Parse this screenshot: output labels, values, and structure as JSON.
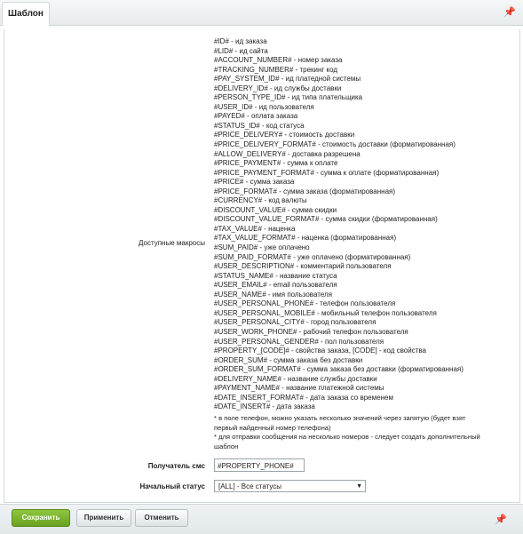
{
  "tabs": [
    {
      "label": "Шаблон"
    }
  ],
  "macros_label": "Доступные макросы",
  "macros": [
    {
      "code": "#ID#",
      "desc": " - ид заказа"
    },
    {
      "code": "#LID#",
      "desc": " - ид сайта"
    },
    {
      "code": "#ACCOUNT_NUMBER#",
      "desc": " - номер заказа"
    },
    {
      "code": "#TRACKING_NUMBER#",
      "desc": " - трекинг код"
    },
    {
      "code": "#PAY_SYSTEM_ID#",
      "desc": " - ид платедной системы"
    },
    {
      "code": "#DELIVERY_ID#",
      "desc": " - ид службы доставки"
    },
    {
      "code": "#PERSON_TYPE_ID#",
      "desc": " - ид типа плательщика"
    },
    {
      "code": "#USER_ID#",
      "desc": " - ид пользователя"
    },
    {
      "code": "#PAYED#",
      "desc": " - оплата заказа"
    },
    {
      "code": "#STATUS_ID#",
      "desc": " - код статуса"
    },
    {
      "code": "#PRICE_DELIVERY#",
      "desc": " - стоимость доставки"
    },
    {
      "code": "#PRICE_DELIVERY_FORMAT#",
      "desc": " - стоимость доставки (форматированная)"
    },
    {
      "code": "#ALLOW_DELIVERY#",
      "desc": " - доставка разрешена"
    },
    {
      "code": "#PRICE_PAYMENT#",
      "desc": " - сумма к оплате"
    },
    {
      "code": "#PRICE_PAYMENT_FORMAT#",
      "desc": " - сумма к оплате (форматированная)"
    },
    {
      "code": "#PRICE#",
      "desc": " - сумма заказа"
    },
    {
      "code": "#PRICE_FORMAT#",
      "desc": " - сумма заказа (форматированная)"
    },
    {
      "code": "#CURRENCY#",
      "desc": " - код валюты"
    },
    {
      "code": "#DISCOUNT_VALUE#",
      "desc": " - сумма скидки"
    },
    {
      "code": "#DISCOUNT_VALUE_FORMAT#",
      "desc": " - сумма скидки (форматированная)"
    },
    {
      "code": "#TAX_VALUE#",
      "desc": " - наценка"
    },
    {
      "code": "#TAX_VALUE_FORMAT#",
      "desc": " - наценка (форматированная)"
    },
    {
      "code": "#SUM_PAID#",
      "desc": " - уже оплачено"
    },
    {
      "code": "#SUM_PAID_FORMAT#",
      "desc": " - уже оплачено (форматированная)"
    },
    {
      "code": "#USER_DESCRIPTION#",
      "desc": " - комментарий пользователя"
    },
    {
      "code": "#STATUS_NAME#",
      "desc": " - название статуса"
    },
    {
      "code": "#USER_EMAIL#",
      "desc": " - email пользователя"
    },
    {
      "code": "#USER_NAME#",
      "desc": " - имя пользователя"
    },
    {
      "code": "#USER_PERSONAL_PHONE#",
      "desc": " - телефон пользователя"
    },
    {
      "code": "#USER_PERSONAL_MOBILE#",
      "desc": " - мобильный телефон пользователя"
    },
    {
      "code": "#USER_PERSONAL_CITY#",
      "desc": " - город пользователя"
    },
    {
      "code": "#USER_WORK_PHONE#",
      "desc": " - рабочий телефон пользователя"
    },
    {
      "code": "#USER_PERSONAL_GENDER#",
      "desc": " - пол пользователя"
    },
    {
      "code": "#PROPERTY_[CODE]#",
      "desc": " - свойства заказа, [CODE] - код свойства"
    },
    {
      "code": "#ORDER_SUM#",
      "desc": " - сумма заказа без доставки"
    },
    {
      "code": "#ORDER_SUM_FORMAT#",
      "desc": " - сумма заказа без доставки (форматированная)"
    },
    {
      "code": "#DELIVERY_NAME#",
      "desc": " - название службы доставки"
    },
    {
      "code": "#PAYMENT_NAME#",
      "desc": " - название платежной системы"
    },
    {
      "code": "#DATE_INSERT_FORMAT#",
      "desc": " - дата заказа со временем"
    },
    {
      "code": "#DATE_INSERT#",
      "desc": " - дата заказа"
    }
  ],
  "notes": {
    "note1": "* в поле телефон, можно указать несколько значений через запятую (будет взят первый найденный номер телефона)",
    "note2": "* для отправки сообщения на несколько номеров - следует создать дополнительный шаблон"
  },
  "recipient": {
    "label": "Получатель смс",
    "value": "#PROPERTY_PHONE#"
  },
  "status": {
    "label": "Начальный статус",
    "value": "[ALL] - Все статусы"
  },
  "buttons": {
    "save": "Сохранить",
    "apply": "Применить",
    "cancel": "Отменить"
  },
  "colors": {
    "save_button": "#7bb32e",
    "border": "#cfd6d9"
  },
  "icons": {
    "pin": "pin-icon",
    "dropdown": "chevron-down-icon"
  }
}
